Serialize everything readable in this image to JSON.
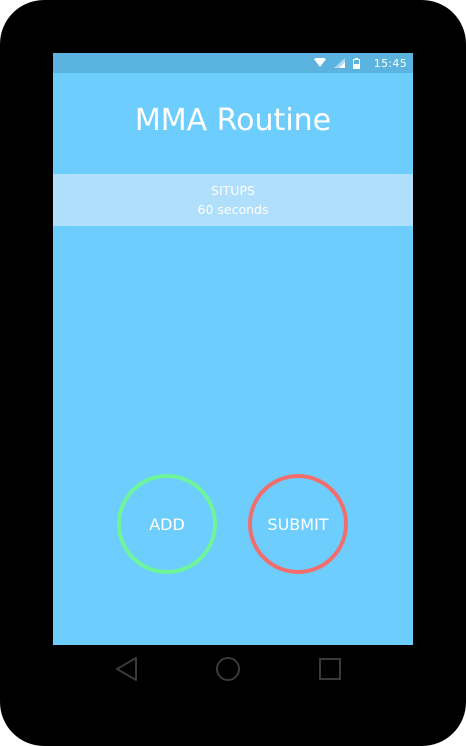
{
  "status_bar": {
    "time": "15:45",
    "icons": [
      "wifi-icon",
      "cell-signal-icon",
      "battery-icon"
    ]
  },
  "app": {
    "title": "MMA Routine"
  },
  "routine_items": [
    {
      "name": "SITUPS",
      "duration": "60 seconds"
    }
  ],
  "buttons": {
    "add_label": "ADD",
    "submit_label": "SUBMIT"
  },
  "navigation": {
    "icons": [
      "back-icon",
      "home-icon",
      "recents-icon"
    ]
  },
  "colors": {
    "background": "#6dcdfd",
    "status_bar": "#5bb4e0",
    "list_item": "#afdffb",
    "add_accent": "#6ef59b",
    "submit_accent": "#f26e6e",
    "device_frame": "#000000"
  }
}
